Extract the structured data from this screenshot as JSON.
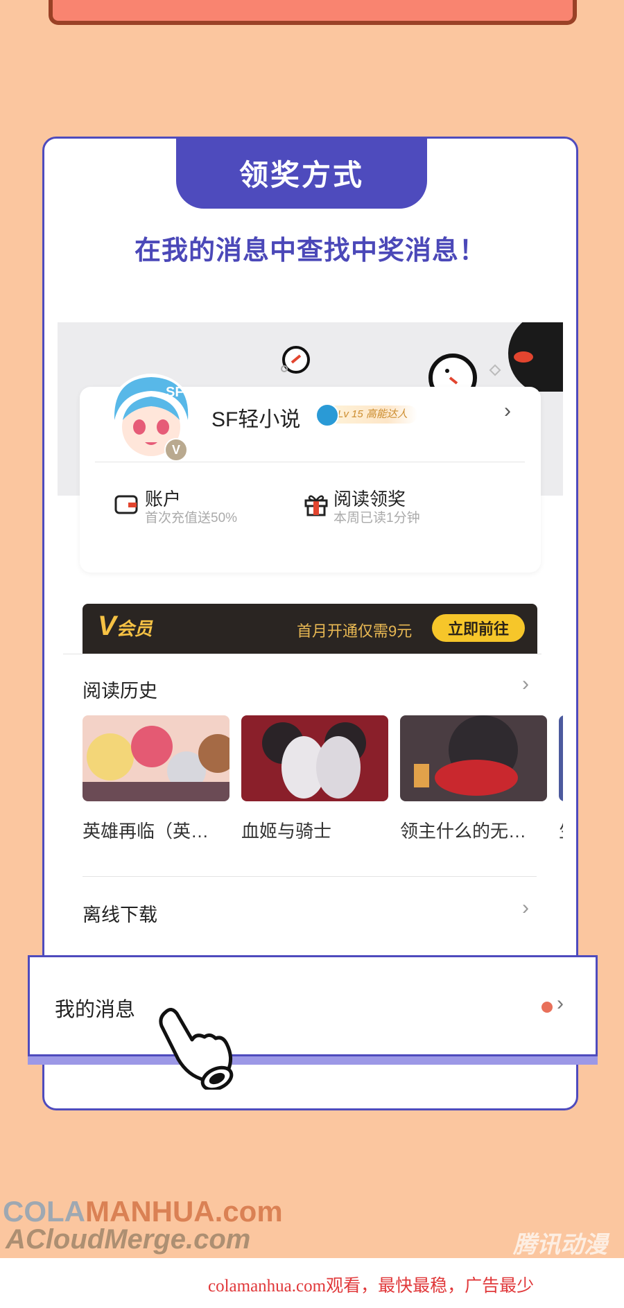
{
  "header": {
    "tab_title": "领奖方式",
    "subtitle": "在我的消息中查找中奖消息！"
  },
  "profile": {
    "username": "SF轻小说",
    "avatar_badge": "V",
    "level_badge": "Lv 15 高能达人",
    "account": {
      "title": "账户",
      "subtitle": "首次充值送50%"
    },
    "reading_reward": {
      "title": "阅读领奖",
      "subtitle": "本周已读1分钟"
    }
  },
  "vip": {
    "logo_letter": "V",
    "logo_text": "会员",
    "promo": "首月开通仅需9元",
    "button": "立即前往"
  },
  "reading_history": {
    "title": "阅读历史",
    "books": [
      {
        "title": "英雄再临（英…"
      },
      {
        "title": "血姬与骑士"
      },
      {
        "title": "领主什么的无…"
      },
      {
        "title": "生"
      }
    ]
  },
  "offline_download": {
    "title": "离线下载"
  },
  "my_messages": {
    "title": "我的消息"
  },
  "watermarks": {
    "line1a": "COLA",
    "line1b": "MANHUA.com",
    "line2": "ACloudMerge.com",
    "logo": "腾讯动漫",
    "footer": "colamanhua.com观看，最快最稳，广告最少"
  },
  "colors": {
    "accent": "#4e4bbd",
    "background": "#fbc69f",
    "vip_gold": "#f6c62a",
    "notify_dot": "#e8705a"
  },
  "icons": [
    "wallet-icon",
    "gift-icon",
    "chevron-right-icon",
    "pointing-hand-icon",
    "level-icon"
  ]
}
